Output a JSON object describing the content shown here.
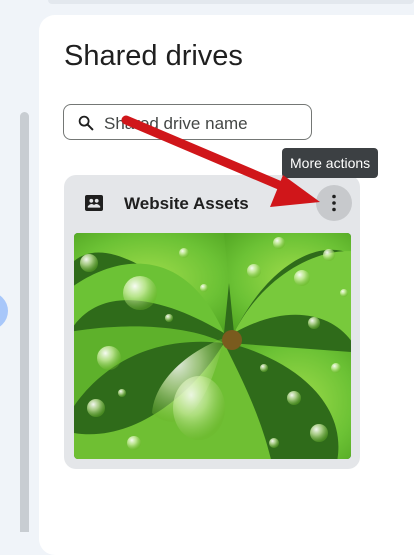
{
  "page": {
    "title": "Shared drives"
  },
  "search": {
    "placeholder": "Shared drive name",
    "icon": "search-icon"
  },
  "tooltip": {
    "text": "More actions"
  },
  "drives": [
    {
      "name": "Website Assets",
      "icon": "shared-drive-icon",
      "thumbnail": "green clover leaf with water droplets",
      "more_actions_icon": "more-vert-icon"
    }
  ],
  "colors": {
    "background": "#f0f4f9",
    "panel": "#ffffff",
    "card": "#e4e6e9",
    "tooltip": "#3c4043",
    "annotation_arrow": "#d0161a"
  }
}
